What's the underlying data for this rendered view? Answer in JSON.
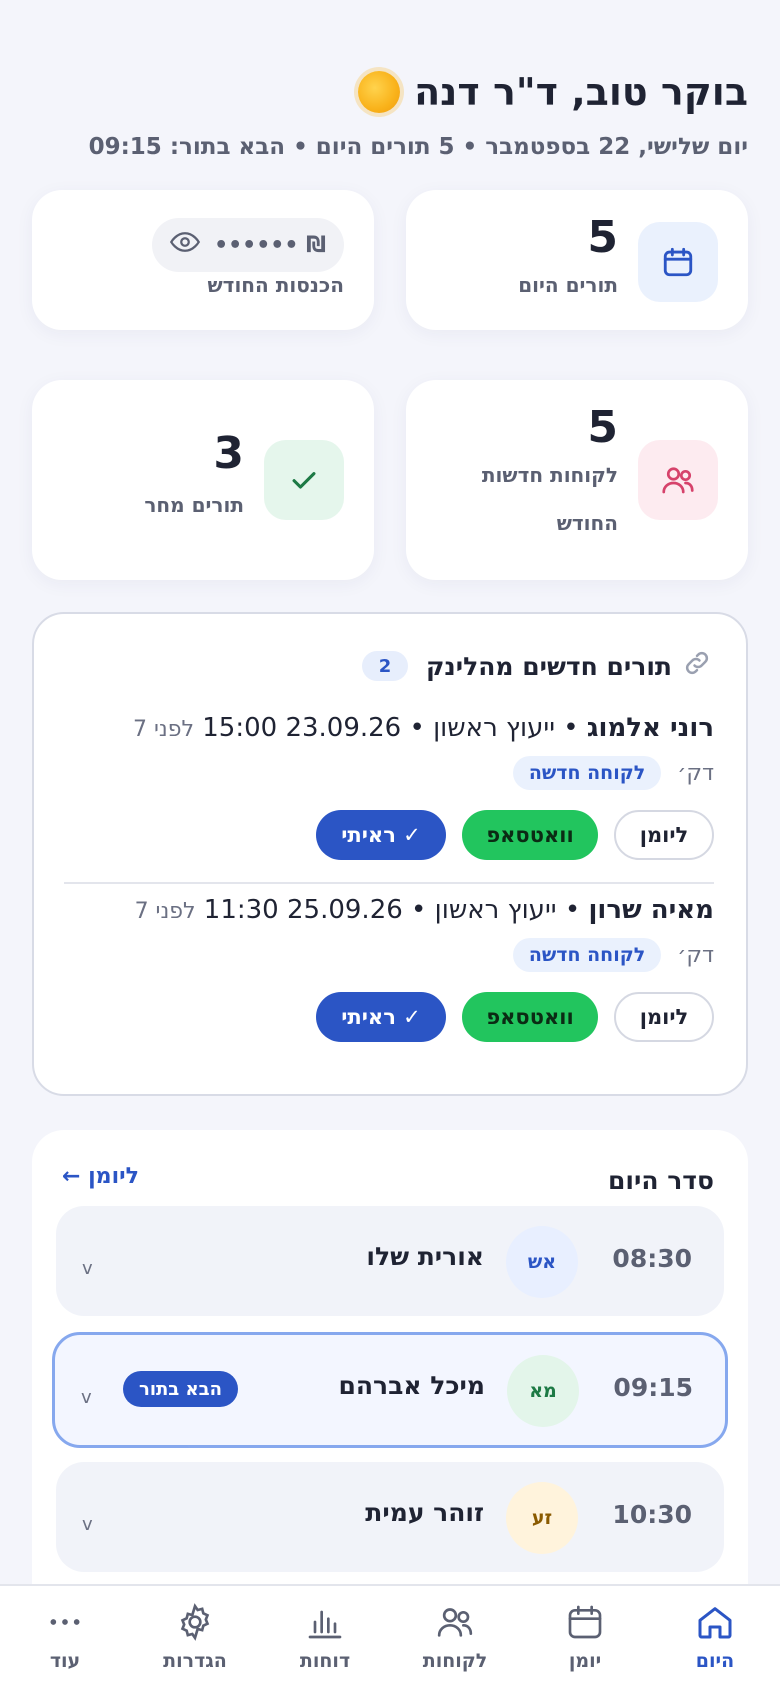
{
  "header": {
    "greeting": "בוקר טוב, ד\"ר דנה",
    "subline": "יום שלישי, 22 בספטמבר • 5 תורים היום • הבא בתור: 09:15"
  },
  "stats": {
    "today": {
      "value": "5",
      "label": "תורים היום"
    },
    "income": {
      "masked": "₪ ••••••",
      "label": "הכנסות החודש"
    },
    "new_clients": {
      "value": "5",
      "label_line1": "לקוחות חדשות",
      "label_line2": "החודש"
    },
    "tomorrow": {
      "value": "3",
      "label": "תורים מחר"
    }
  },
  "link_appointments": {
    "title": "תורים חדשים מהלינק",
    "count": "2",
    "items": [
      {
        "name": "רוני אלמוג",
        "service": "ייעוץ ראשון",
        "date_time": "23.09.26 15:00",
        "ago_a": "לפני 7",
        "ago_b": "דק׳",
        "tag": "לקוחה חדשה"
      },
      {
        "name": "מאיה שרון",
        "service": "ייעוץ ראשון",
        "date_time": "25.09.26 11:30",
        "ago_a": "לפני 7",
        "ago_b": "דק׳",
        "tag": "לקוחה חדשה"
      }
    ],
    "buttons": {
      "calendar": "ליומן",
      "whatsapp": "וואטסאפ",
      "seen": "✓ ראיתי"
    }
  },
  "schedule": {
    "title": "סדר היום",
    "link": "ליומן ←",
    "rows": [
      {
        "time": "08:30",
        "initials": "אש",
        "name": "אורית שלו",
        "chevron": "v"
      },
      {
        "time": "09:15",
        "initials": "מא",
        "name": "מיכל אברהם",
        "badge": "הבא בתור",
        "chevron": "v"
      },
      {
        "time": "10:30",
        "initials": "זע",
        "name": "זוהר עמית",
        "chevron": "v"
      }
    ]
  },
  "nav": {
    "items": [
      {
        "label": "היום",
        "icon": "home-icon",
        "active": true
      },
      {
        "label": "יומן",
        "icon": "calendar-icon"
      },
      {
        "label": "לקוחות",
        "icon": "users-icon"
      },
      {
        "label": "דוחות",
        "icon": "bar-chart-icon"
      },
      {
        "label": "הגדרות",
        "icon": "gear-icon"
      },
      {
        "label": "עוד",
        "icon": "more-icon"
      }
    ]
  },
  "colors": {
    "accent": "#2b55c5",
    "whatsapp": "#22c55e",
    "background": "#f4f5fb"
  }
}
